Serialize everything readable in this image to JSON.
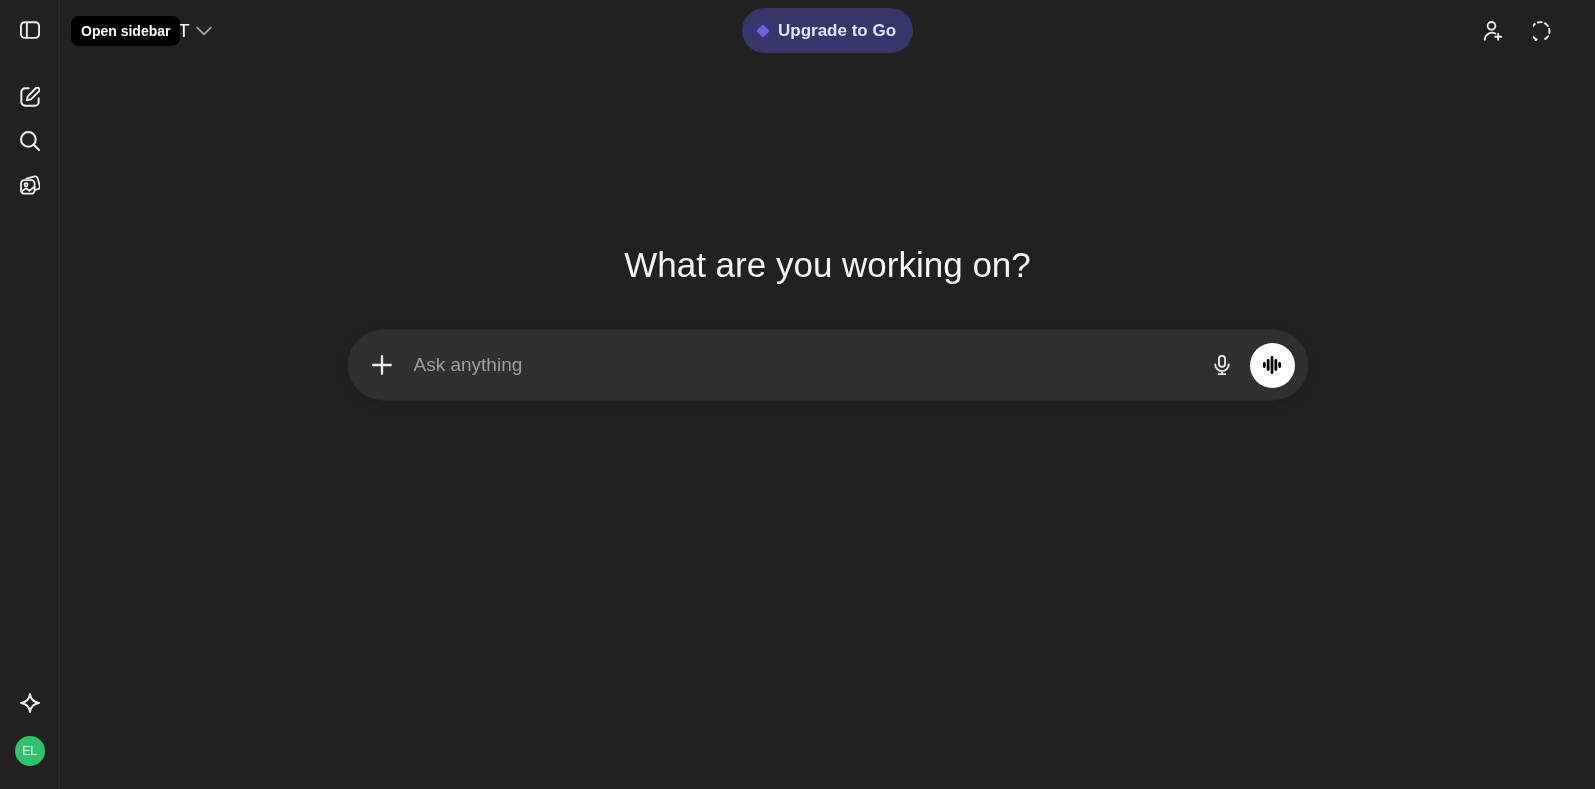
{
  "sidebar": {
    "tooltip": "Open sidebar",
    "avatar_initials": "EL"
  },
  "header": {
    "model_selector": "T",
    "upgrade_button": "Upgrade to Go"
  },
  "main": {
    "heading": "What are you working on?",
    "composer": {
      "placeholder": "Ask anything"
    }
  }
}
